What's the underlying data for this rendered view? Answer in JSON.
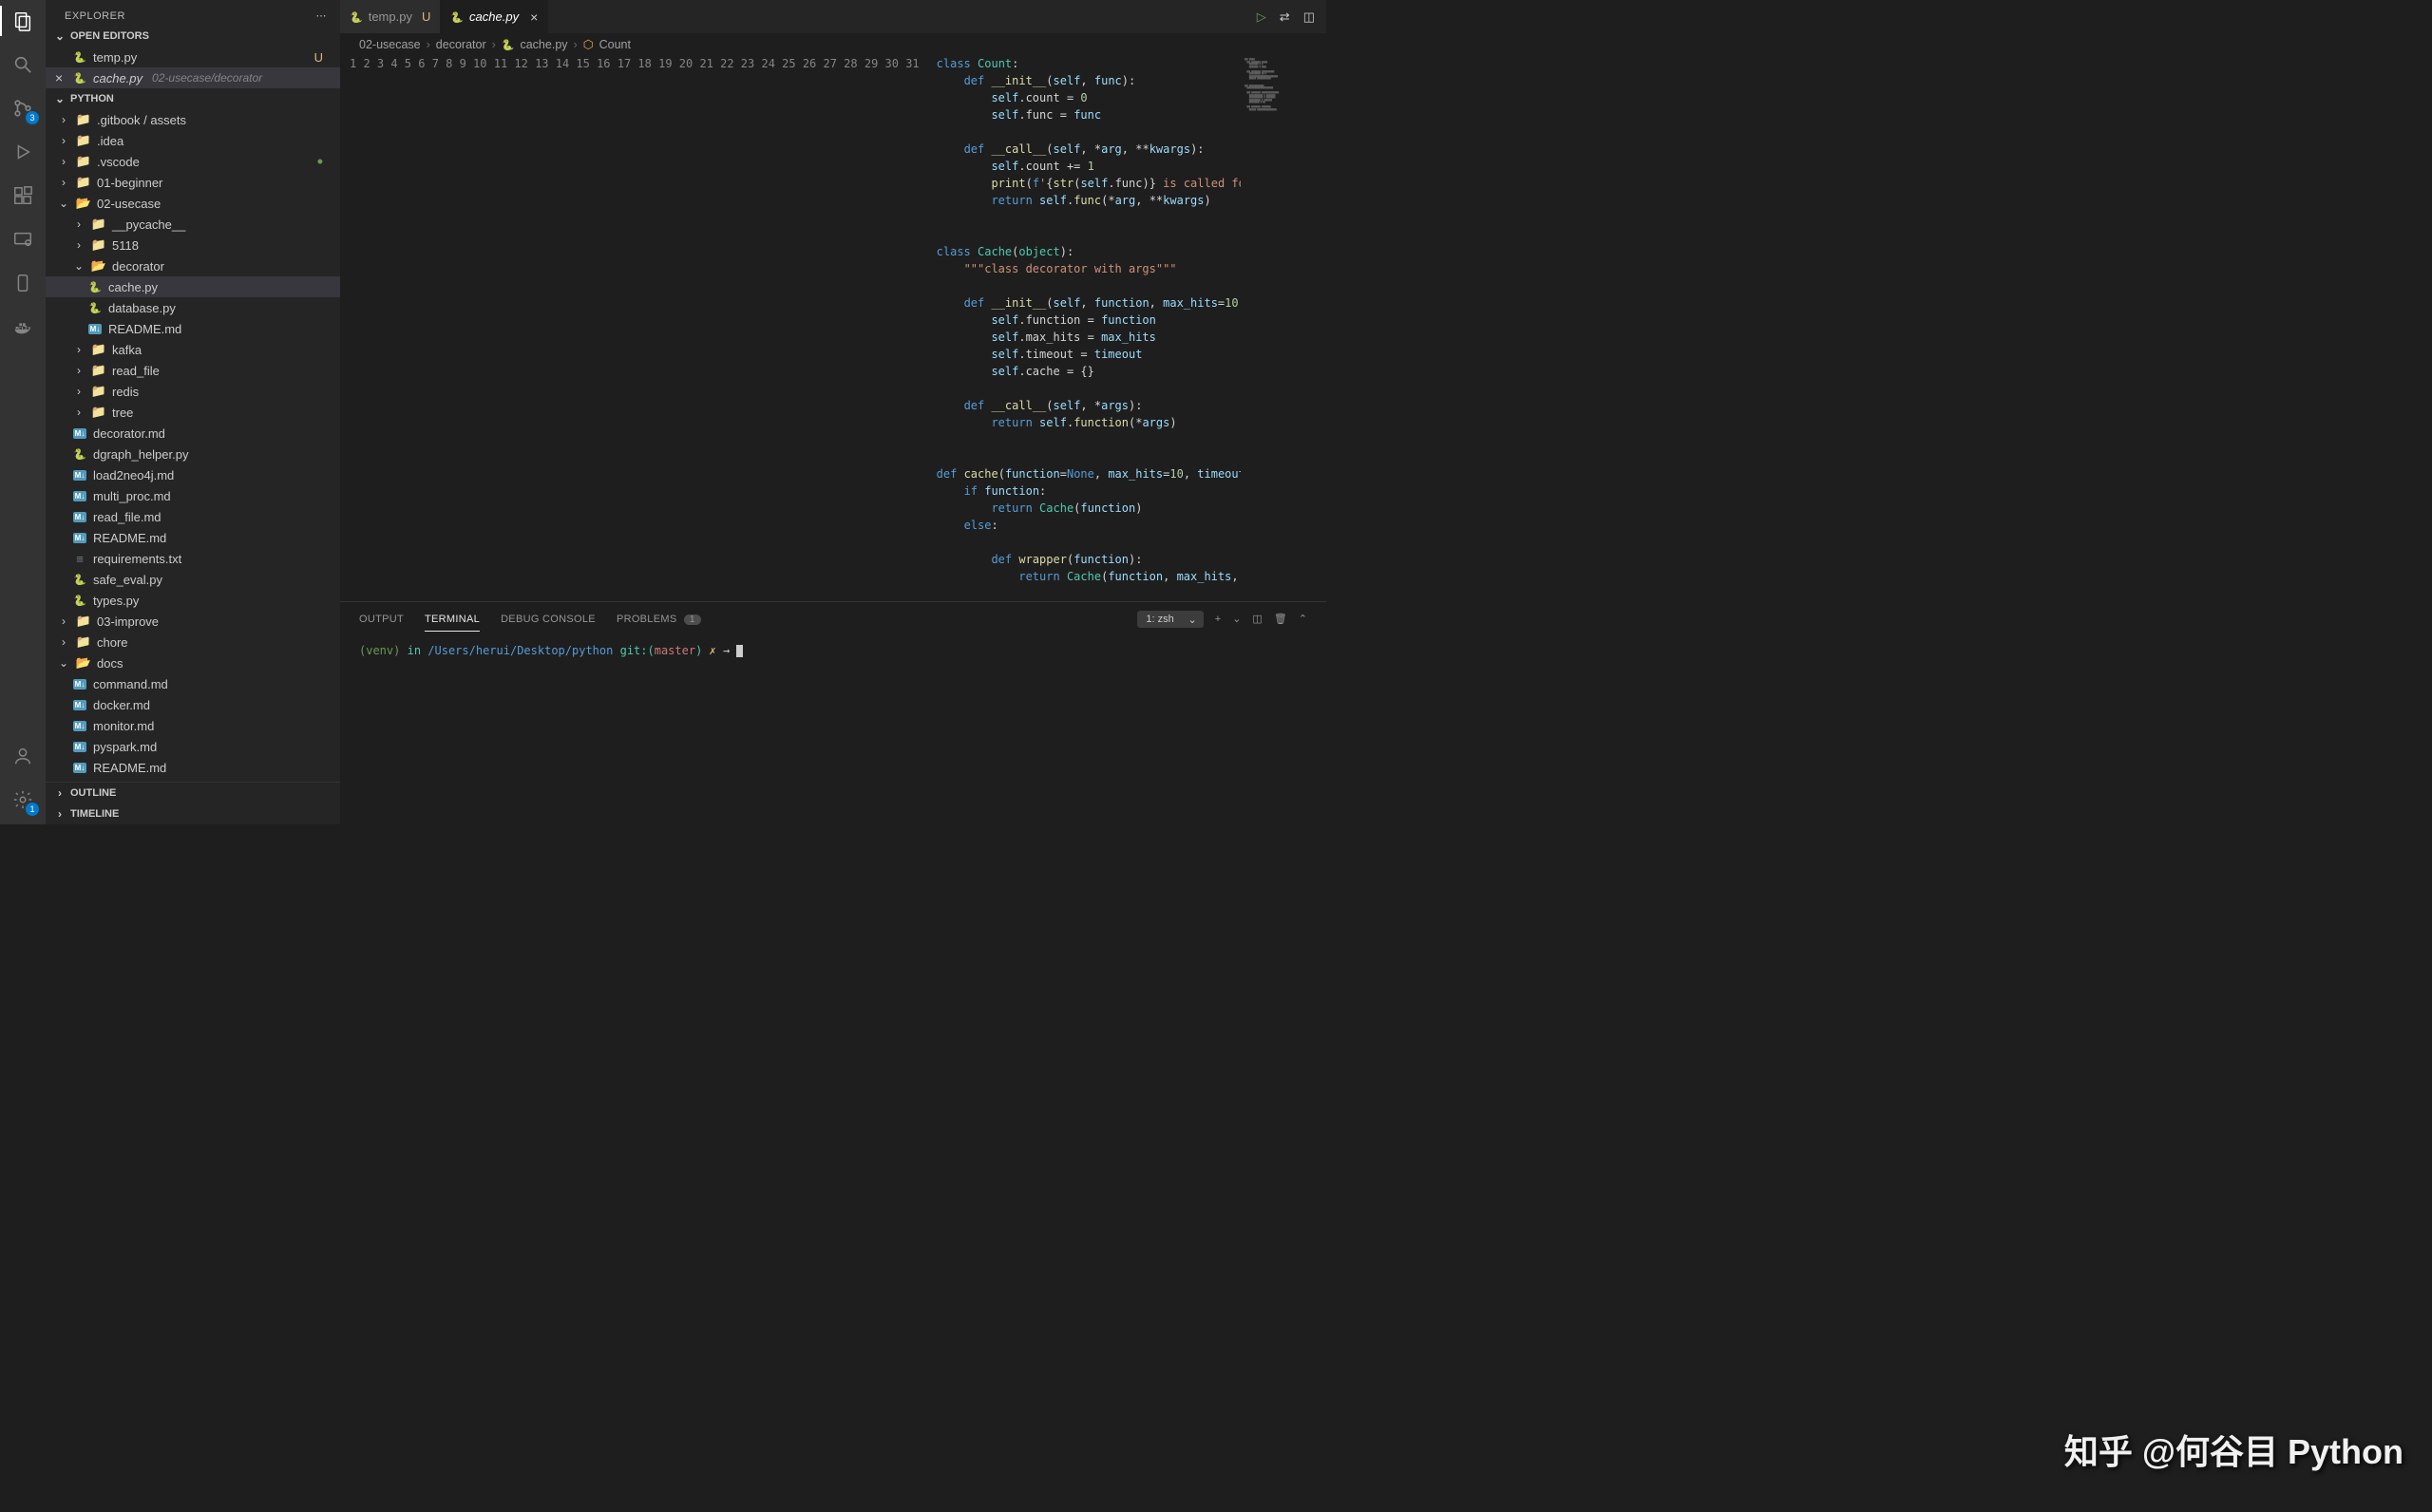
{
  "activity": {
    "scm_badge": "3",
    "settings_badge": "1"
  },
  "sidebar": {
    "title": "EXPLORER",
    "open_editors": "OPEN EDITORS",
    "oe": [
      {
        "name": "temp.py",
        "mod": "U"
      },
      {
        "name": "cache.py",
        "hint": "02-usecase/decorator"
      }
    ],
    "root": "PYTHON",
    "items": [
      {
        "p": 0,
        "ic": "folder",
        "label": ".gitbook / assets"
      },
      {
        "p": 0,
        "ic": "folder",
        "label": ".idea"
      },
      {
        "p": 0,
        "ic": "folder",
        "label": ".vscode",
        "dot": true
      },
      {
        "p": 0,
        "ic": "folder",
        "label": "01-beginner"
      },
      {
        "p": 0,
        "ic": "folder-open",
        "label": "02-usecase",
        "yellow": true
      },
      {
        "p": 1,
        "ic": "folder",
        "label": "__pycache__"
      },
      {
        "p": 1,
        "ic": "folder",
        "label": "5118"
      },
      {
        "p": 1,
        "ic": "folder-open",
        "label": "decorator",
        "yellow": true
      },
      {
        "p": 2,
        "ic": "py",
        "label": "cache.py",
        "sel": true
      },
      {
        "p": 2,
        "ic": "py",
        "label": "database.py"
      },
      {
        "p": 2,
        "ic": "md",
        "label": "README.md"
      },
      {
        "p": 1,
        "ic": "folder",
        "label": "kafka"
      },
      {
        "p": 1,
        "ic": "folder",
        "label": "read_file"
      },
      {
        "p": 1,
        "ic": "folder",
        "label": "redis"
      },
      {
        "p": 1,
        "ic": "folder",
        "label": "tree"
      },
      {
        "p": 1,
        "ic": "md",
        "label": "decorator.md"
      },
      {
        "p": 1,
        "ic": "py",
        "label": "dgraph_helper.py"
      },
      {
        "p": 1,
        "ic": "md",
        "label": "load2neo4j.md"
      },
      {
        "p": 1,
        "ic": "md",
        "label": "multi_proc.md"
      },
      {
        "p": 1,
        "ic": "md",
        "label": "read_file.md"
      },
      {
        "p": 1,
        "ic": "md",
        "label": "README.md"
      },
      {
        "p": 1,
        "ic": "set",
        "label": "requirements.txt"
      },
      {
        "p": 1,
        "ic": "py",
        "label": "safe_eval.py"
      },
      {
        "p": 1,
        "ic": "py",
        "label": "types.py"
      },
      {
        "p": 0,
        "ic": "folder",
        "label": "03-improve"
      },
      {
        "p": 0,
        "ic": "folder",
        "label": "chore"
      },
      {
        "p": 0,
        "ic": "folder-open",
        "label": "docs",
        "yellow": true
      },
      {
        "p": 1,
        "ic": "md",
        "label": "command.md"
      },
      {
        "p": 1,
        "ic": "md",
        "label": "docker.md"
      },
      {
        "p": 1,
        "ic": "md",
        "label": "monitor.md"
      },
      {
        "p": 1,
        "ic": "md",
        "label": "pyspark.md"
      },
      {
        "p": 1,
        "ic": "md",
        "label": "README.md"
      }
    ],
    "outline": "OUTLINE",
    "timeline": "TIMELINE"
  },
  "tabs": [
    {
      "name": "temp.py",
      "mod": "U"
    },
    {
      "name": "cache.py",
      "italic": true,
      "active": true,
      "close": true
    }
  ],
  "breadcrumb": [
    "02-usecase",
    "decorator",
    "cache.py",
    "Count"
  ],
  "code_lines_count": 31,
  "panel": {
    "tabs": {
      "output": "OUTPUT",
      "terminal": "TERMINAL",
      "debug": "DEBUG CONSOLE",
      "problems": "PROBLEMS",
      "problems_count": "1"
    },
    "term_select": "1: zsh",
    "term": {
      "venv": "(venv)",
      "in": "in",
      "path": "/Users/herui/Desktop/python",
      "git": "git:(",
      "branch": "master",
      "gitend": ")",
      "dirty": "✗",
      "prompt": "→"
    }
  },
  "watermark": "知乎 @何谷目 Python"
}
